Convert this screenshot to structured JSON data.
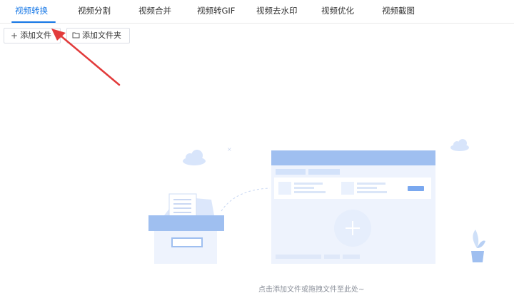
{
  "tabs": [
    {
      "label": "视频转换",
      "active": true
    },
    {
      "label": "视频分割",
      "active": false
    },
    {
      "label": "视频合并",
      "active": false
    },
    {
      "label": "视频转GIF",
      "active": false
    },
    {
      "label": "视频去水印",
      "active": false
    },
    {
      "label": "视频优化",
      "active": false
    },
    {
      "label": "视频截图",
      "active": false
    }
  ],
  "toolbar": {
    "add_file_label": "添加文件",
    "add_folder_label": "添加文件夹",
    "add_file_icon": "plus-icon",
    "add_folder_icon": "folder-icon"
  },
  "dropzone": {
    "hint": "点击添加文件或拖拽文件至此处~"
  },
  "colors": {
    "accent": "#1677e6",
    "annotation_arrow": "#e23b3b",
    "illustration_blue": "#9fbff0",
    "illustration_light": "#eef3fd"
  }
}
